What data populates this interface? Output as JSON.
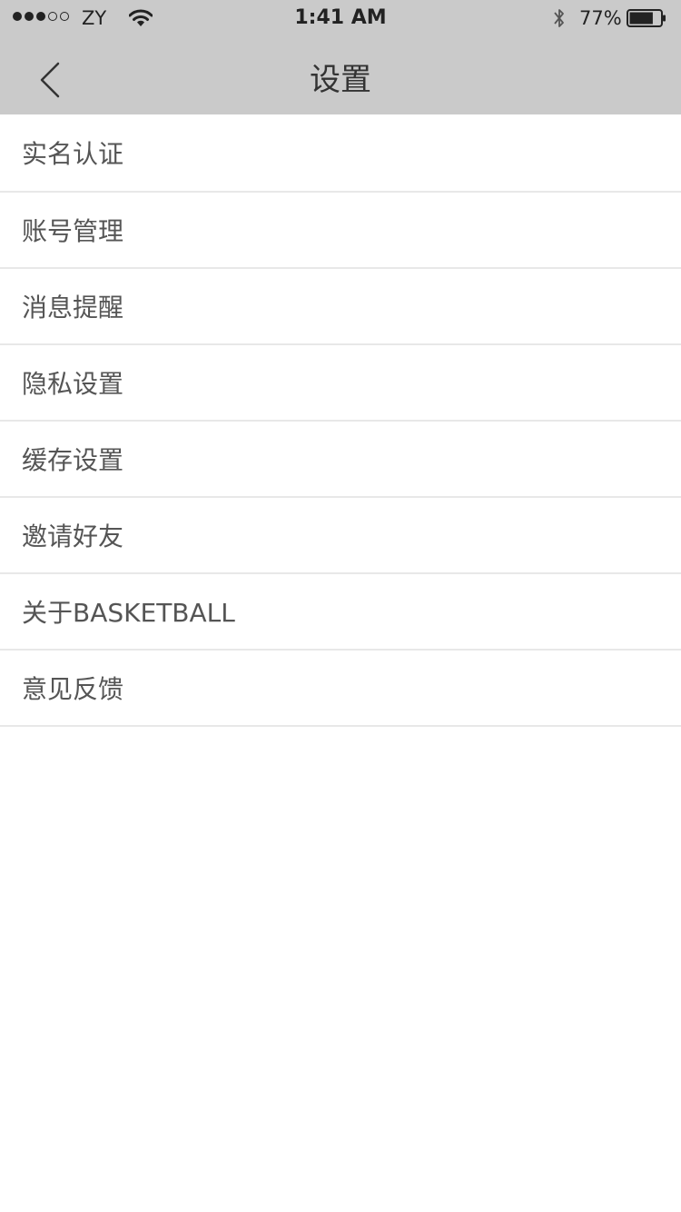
{
  "status_bar": {
    "carrier": "ZY",
    "time": "1:41 AM",
    "battery_percent": "77%",
    "battery_level": 0.77,
    "signal_bars_filled": 3,
    "signal_bars_total": 5
  },
  "nav": {
    "title": "设置",
    "back_icon": "chevron-left-icon"
  },
  "menu": {
    "items": [
      {
        "label": "实名认证"
      },
      {
        "label": "账号管理"
      },
      {
        "label": "消息提醒"
      },
      {
        "label": "隐私设置"
      },
      {
        "label": "缓存设置"
      },
      {
        "label": "邀请好友"
      },
      {
        "label": "关于BASKETBALL"
      },
      {
        "label": "意见反馈"
      }
    ]
  },
  "colors": {
    "header_bg": "#cacaca",
    "text": "#555555",
    "divider": "#e8e8e8"
  }
}
